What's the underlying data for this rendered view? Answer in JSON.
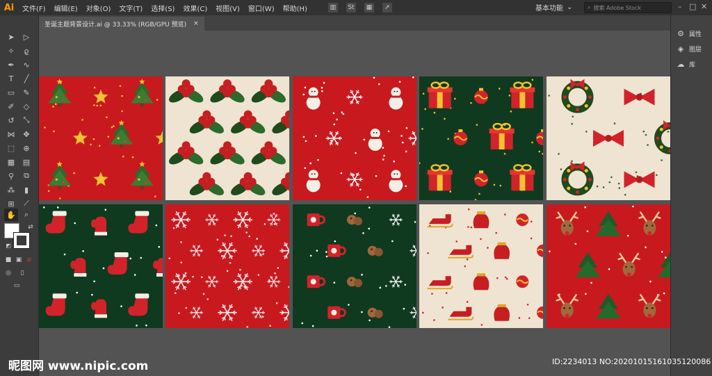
{
  "app": {
    "logo": "Ai",
    "menu": [
      "文件(F)",
      "编辑(E)",
      "对象(O)",
      "文字(T)",
      "选择(S)",
      "效果(C)",
      "视图(V)",
      "窗口(W)",
      "帮助(H)"
    ],
    "workspace": "基本功能",
    "search_placeholder": "搜索 Adobe Stock",
    "icons": [
      "bridge-icon",
      "stock-icon",
      "arrange-icon",
      "gpu-icon"
    ]
  },
  "document": {
    "tab_title": "圣诞主题背景设计.ai @ 33.33% (RGB/GPU 预览)",
    "close": "×"
  },
  "right_panel": {
    "items": [
      {
        "label": "属性",
        "icon": "properties-icon"
      },
      {
        "label": "图层",
        "icon": "layers-icon"
      },
      {
        "label": "库",
        "icon": "libraries-icon"
      }
    ]
  },
  "swatches": {
    "fill": "#ffffff",
    "stroke": "#ffffff"
  },
  "patterns": [
    {
      "theme": "christmas-trees-stars",
      "bg": "#c8191f"
    },
    {
      "theme": "holly-berries",
      "bg": "#efe4d1"
    },
    {
      "theme": "snowmen-snowflakes",
      "bg": "#c8191f"
    },
    {
      "theme": "gifts-ornaments",
      "bg": "#0f3a1f"
    },
    {
      "theme": "wreaths-bows",
      "bg": "#efe4d1"
    },
    {
      "theme": "stockings-mittens",
      "bg": "#0f3a1f"
    },
    {
      "theme": "snowflakes",
      "bg": "#c8191f"
    },
    {
      "theme": "mugs-cookies",
      "bg": "#0f3a1f"
    },
    {
      "theme": "sleighs-bags",
      "bg": "#efe4d1"
    },
    {
      "theme": "reindeer-trees",
      "bg": "#c8191f"
    }
  ],
  "watermark": {
    "site": "昵图网 www.nipic.com",
    "id": "ID:2234013 NO:20201015161035120086"
  }
}
